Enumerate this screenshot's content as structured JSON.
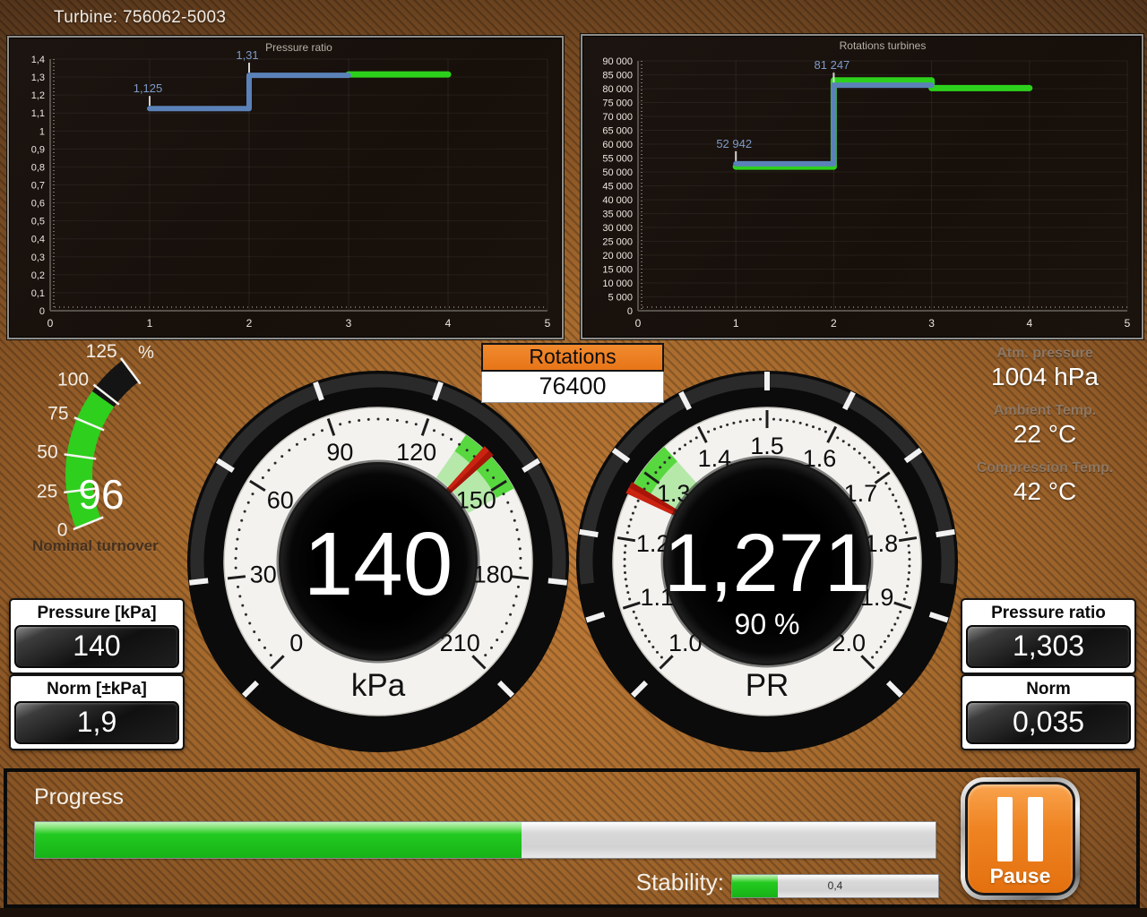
{
  "win": {
    "title": "Turbine: 756062-5003"
  },
  "colors": {
    "blue": "#5b82b8",
    "green": "#2dd11c",
    "orange": "#ed7d23",
    "needle": "#a81408"
  },
  "chart_data": [
    {
      "type": "line",
      "title": "Pressure ratio",
      "xlim": [
        0,
        5
      ],
      "ylim": [
        0,
        1.4
      ],
      "grid": true,
      "x_ticks": [
        [
          0,
          "0"
        ],
        [
          1,
          "1"
        ],
        [
          2,
          "2"
        ],
        [
          3,
          "3"
        ],
        [
          4,
          "4"
        ],
        [
          5,
          "5"
        ]
      ],
      "y_ticks": [
        [
          1.4,
          "1,4"
        ],
        [
          1.3,
          "1,3"
        ],
        [
          1.2,
          "1,2"
        ],
        [
          1.1,
          "1,1"
        ],
        [
          1,
          "1"
        ],
        [
          0.9,
          "0,9"
        ],
        [
          0.8,
          "0,8"
        ],
        [
          0.7,
          "0,7"
        ],
        [
          0.6,
          "0,6"
        ],
        [
          0.5,
          "0,5"
        ],
        [
          0.4,
          "0,4"
        ],
        [
          0.3,
          "0,3"
        ],
        [
          0.2,
          "0,2"
        ],
        [
          0.1,
          "0,1"
        ],
        [
          0,
          "0"
        ]
      ],
      "series": [
        {
          "name": "actual",
          "color": "green",
          "width": 7,
          "points": [
            [
              3,
              1.315
            ],
            [
              4,
              1.315
            ]
          ]
        },
        {
          "name": "setpoint",
          "color": "blue",
          "width": 6,
          "points": [
            [
              1,
              1.125
            ],
            [
              2,
              1.125
            ],
            [
              2,
              1.31
            ],
            [
              3,
              1.31
            ]
          ]
        }
      ],
      "annotations": [
        {
          "x": 1,
          "y": 1.125,
          "label": "1,125"
        },
        {
          "x": 2,
          "y": 1.31,
          "label": "1,31"
        }
      ]
    },
    {
      "type": "line",
      "title": "Rotations turbines",
      "xlim": [
        0,
        5
      ],
      "ylim": [
        0,
        90000
      ],
      "grid": true,
      "x_ticks": [
        [
          0,
          "0"
        ],
        [
          1,
          "1"
        ],
        [
          2,
          "2"
        ],
        [
          3,
          "3"
        ],
        [
          4,
          "4"
        ],
        [
          5,
          "5"
        ]
      ],
      "y_ticks": [
        [
          90000,
          "90 000"
        ],
        [
          85000,
          "85 000"
        ],
        [
          80000,
          "80 000"
        ],
        [
          75000,
          "75 000"
        ],
        [
          70000,
          "70 000"
        ],
        [
          65000,
          "65 000"
        ],
        [
          60000,
          "60 000"
        ],
        [
          55000,
          "55 000"
        ],
        [
          50000,
          "50 000"
        ],
        [
          45000,
          "45 000"
        ],
        [
          40000,
          "40 000"
        ],
        [
          35000,
          "35 000"
        ],
        [
          30000,
          "30 000"
        ],
        [
          25000,
          "25 000"
        ],
        [
          20000,
          "20 000"
        ],
        [
          15000,
          "15 000"
        ],
        [
          10000,
          "10 000"
        ],
        [
          5000,
          "5 000"
        ],
        [
          0,
          "0"
        ]
      ],
      "series": [
        {
          "name": "actual",
          "color": "green",
          "width": 7,
          "points": [
            [
              1,
              51900
            ],
            [
              2,
              51900
            ],
            [
              2,
              83000
            ],
            [
              3,
              83000
            ],
            [
              3,
              80200
            ],
            [
              4,
              80200
            ]
          ]
        },
        {
          "name": "setpoint",
          "color": "blue",
          "width": 6,
          "points": [
            [
              1,
              52942
            ],
            [
              2,
              52942
            ],
            [
              2,
              81247
            ],
            [
              3,
              81247
            ]
          ]
        }
      ],
      "annotations": [
        {
          "x": 1,
          "y": 52942,
          "label": "52 942"
        },
        {
          "x": 2,
          "y": 81247,
          "label": "81 247"
        }
      ]
    }
  ],
  "turnover": {
    "unit": "%",
    "min": 0,
    "max": 125,
    "value": 96,
    "value_display": "96",
    "ticks": [
      [
        0,
        "0"
      ],
      [
        25,
        "25"
      ],
      [
        50,
        "50"
      ],
      [
        75,
        "75"
      ],
      [
        100,
        "100"
      ],
      [
        125,
        "125"
      ]
    ],
    "label": "Nominal turnover"
  },
  "rotations": {
    "label": "Rotations",
    "value": "76400"
  },
  "gauges": {
    "pressure": {
      "min": 0,
      "max": 210,
      "value": 140,
      "value_display": "140",
      "unit": "kPa",
      "minor_step": 3,
      "major_step": 30,
      "green_zone": [
        132,
        153
      ],
      "majors": [
        [
          0,
          "0"
        ],
        [
          30,
          "30"
        ],
        [
          60,
          "60"
        ],
        [
          90,
          "90"
        ],
        [
          120,
          "120"
        ],
        [
          150,
          "150"
        ],
        [
          180,
          "180"
        ],
        [
          210,
          "210"
        ]
      ]
    },
    "ratio": {
      "min": 1,
      "max": 2,
      "value": 1.271,
      "value_display": "1,271",
      "sub_display": "90 %",
      "unit": "PR",
      "minor_step": 0.01,
      "major_step": 0.1,
      "green_zone": [
        1.275,
        1.345
      ],
      "majors": [
        [
          1,
          "1.0"
        ],
        [
          1.1,
          "1.1"
        ],
        [
          1.2,
          "1.2"
        ],
        [
          1.3,
          "1.3"
        ],
        [
          1.4,
          "1.4"
        ],
        [
          1.5,
          "1.5"
        ],
        [
          1.6,
          "1.6"
        ],
        [
          1.7,
          "1.7"
        ],
        [
          1.8,
          "1.8"
        ],
        [
          1.9,
          "1.9"
        ],
        [
          2,
          "2.0"
        ]
      ]
    }
  },
  "env": {
    "items": [
      {
        "label": "Atm. pressure",
        "value": "1004 hPa"
      },
      {
        "label": "Ambient Temp.",
        "value": "22 °C"
      },
      {
        "label": "Compression Temp.",
        "value": "42 °C"
      }
    ]
  },
  "left_boxes": [
    {
      "label": "Pressure [kPa]",
      "value": "140"
    },
    {
      "label": "Norm [±kPa]",
      "value": "1,9"
    }
  ],
  "right_boxes": [
    {
      "label": "Pressure ratio",
      "value": "1,303"
    },
    {
      "label": "Norm",
      "value": "0,035"
    }
  ],
  "footer": {
    "progress_label": "Progress",
    "progress_percent": 54,
    "stability_label": "Stability:",
    "stability_display": "0,4",
    "stability_percent": 22,
    "pause_label": "Pause"
  }
}
